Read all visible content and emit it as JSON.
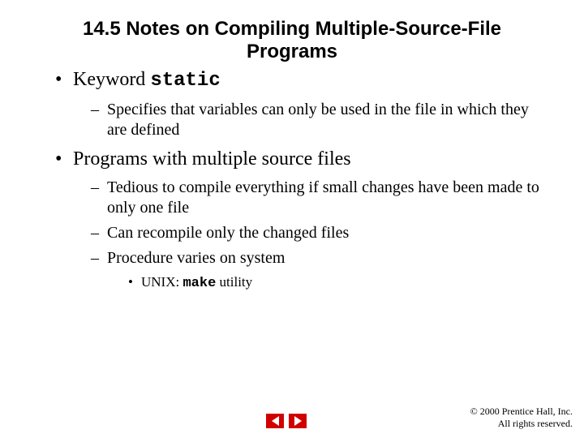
{
  "title": "14.5   Notes on Compiling Multiple-Source-File Programs",
  "bullets": {
    "b1_prefix": "Keyword ",
    "b1_code": "static",
    "b1_sub1": "Specifies that variables can only be used in the file in which they are defined",
    "b2": "Programs with multiple source files",
    "b2_sub1": "Tedious to compile everything if small changes have been made to only one file",
    "b2_sub2": "Can recompile only the changed files",
    "b2_sub3": "Procedure varies on system",
    "b2_sub3_a_prefix": "UNIX: ",
    "b2_sub3_a_code": "make",
    "b2_sub3_a_suffix": " utility"
  },
  "footer": {
    "line1": "© 2000 Prentice Hall, Inc.",
    "line2": "All rights reserved."
  }
}
